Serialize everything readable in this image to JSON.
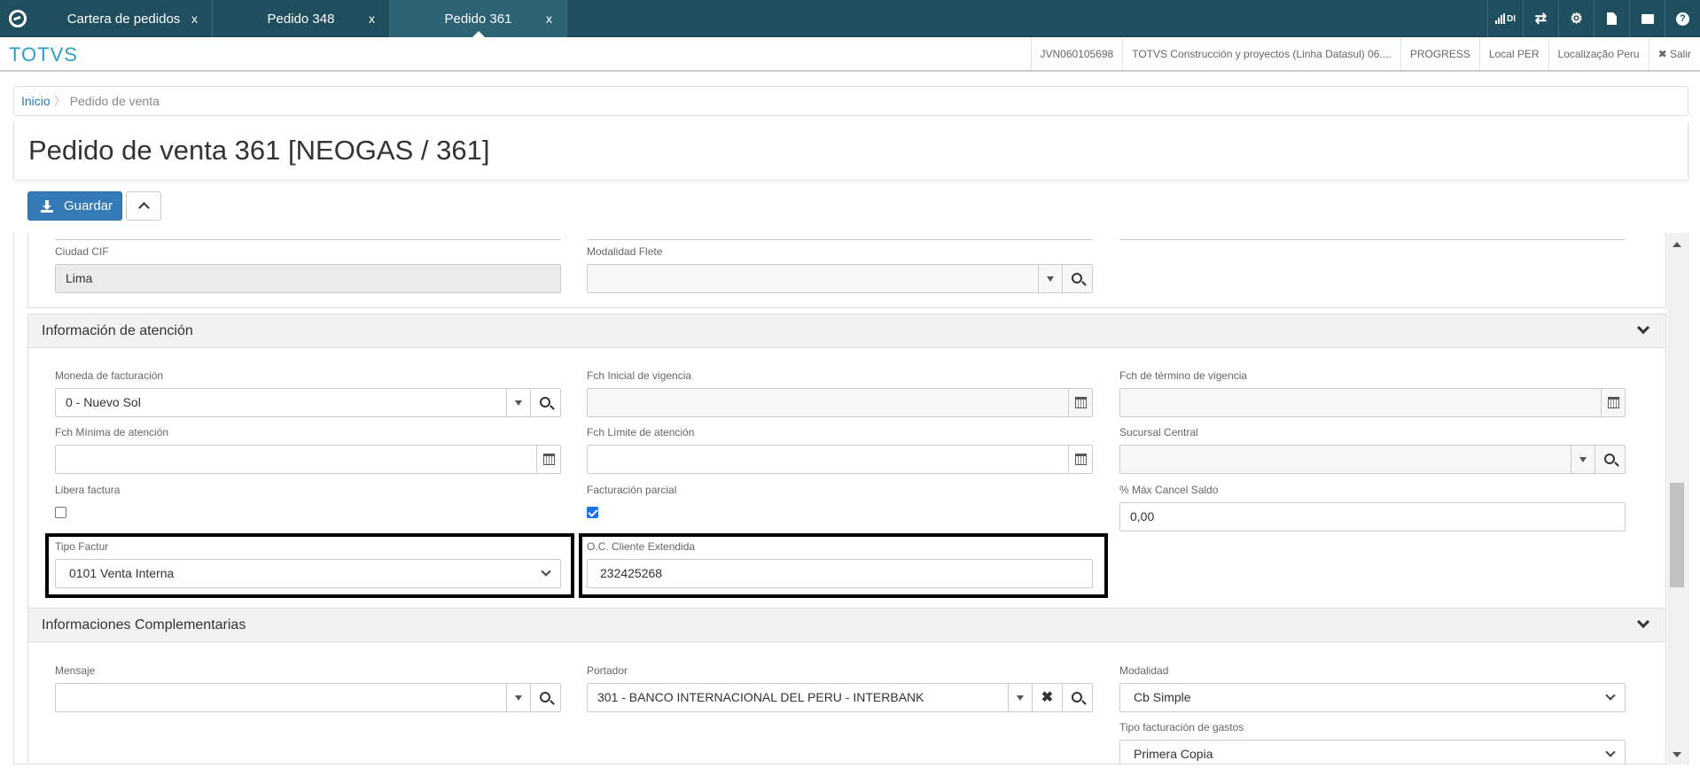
{
  "tabs": [
    {
      "label": "Cartera de pedidos",
      "close": "x"
    },
    {
      "label": "Pedido 348",
      "close": "x"
    },
    {
      "label": "Pedido 361",
      "close": "x"
    }
  ],
  "top_icons": [
    "signal-icon",
    "shuffle-icon",
    "gear-icon",
    "document-icon",
    "chat-icon",
    "help-icon"
  ],
  "top_icon_text": {
    "signal": "DI",
    "help": "?"
  },
  "brand": "TOTVS",
  "header_links": [
    "JVN060105698",
    "TOTVS Construcción y proyectos (Linha Datasul) 06....",
    "PROGRESS",
    "Local PER",
    "Localização Peru",
    "✖ Salir"
  ],
  "breadcrumb": {
    "home": "Inicio",
    "current": "Pedido de venta"
  },
  "page_title": "Pedido de venta 361 [NEOGAS / 361]",
  "save_label": "Guardar",
  "top_fields": {
    "ciudad_cif_label": "Ciudad CIF",
    "ciudad_cif_value": "Lima",
    "modalidad_flete_label": "Modalidad Flete",
    "modalidad_flete_value": ""
  },
  "atencion": {
    "title": "Información de atención",
    "moneda_label": "Moneda de facturación",
    "moneda_value": "0 - Nuevo Sol",
    "fch_inicial_label": "Fch Inicial de vigencia",
    "fch_termino_label": "Fch de término de vigencia",
    "fch_minima_label": "Fch Mínima de atención",
    "fch_limite_label": "Fch Límite de atención",
    "sucursal_label": "Sucursal Central",
    "libera_label": "Libera factura",
    "libera_checked": false,
    "parcial_label": "Facturación parcial",
    "parcial_checked": true,
    "max_cancel_label": "% Máx Cancel Saldo",
    "max_cancel_value": "0,00",
    "tipo_factur_label": "Tipo Factur",
    "tipo_factur_value": "0101 Venta Interna",
    "oc_label": "O.C. Cliente Extendida",
    "oc_value": "232425268"
  },
  "complementarias": {
    "title": "Informaciones Complementarias",
    "mensaje_label": "Mensaje",
    "mensaje_value": "",
    "portador_label": "Portador",
    "portador_value": "301 - BANCO INTERNACIONAL DEL PERU - INTERBANK",
    "modalidad_label": "Modalidad",
    "modalidad_value": "Cb Simple",
    "tipo_gastos_label": "Tipo facturación de gastos",
    "tipo_gastos_value": "Primera Copia"
  }
}
